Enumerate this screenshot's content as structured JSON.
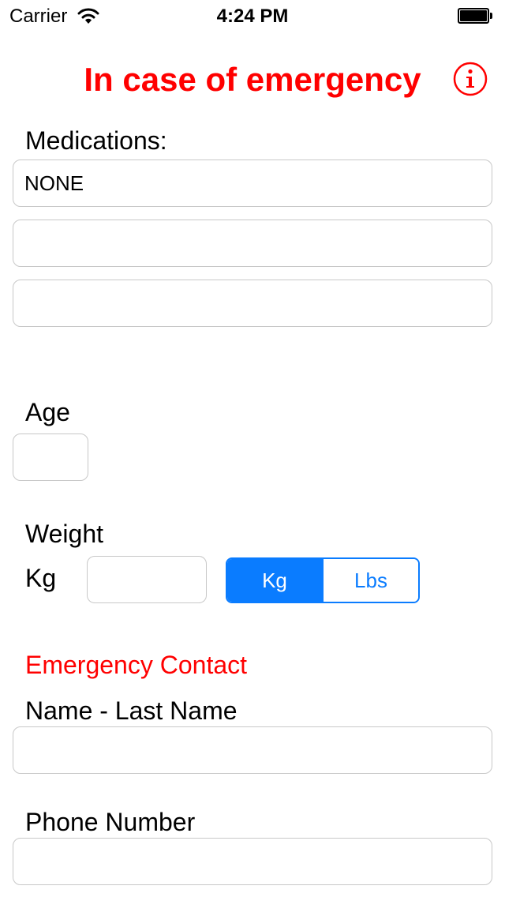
{
  "status_bar": {
    "carrier": "Carrier",
    "time": "4:24 PM",
    "icons": [
      "wifi-icon",
      "battery-icon"
    ]
  },
  "header": {
    "title": "In case of emergency",
    "info_icon": "info-icon",
    "accent_color": "#ff0000"
  },
  "medications": {
    "label": "Medications:",
    "fields": [
      {
        "value": "NONE",
        "placeholder": ""
      },
      {
        "value": "",
        "placeholder": ""
      },
      {
        "value": "",
        "placeholder": ""
      }
    ]
  },
  "age": {
    "label": "Age",
    "value": ""
  },
  "weight": {
    "label": "Weight",
    "unit_label": "Kg",
    "value": "",
    "segments": [
      {
        "label": "Kg",
        "selected": true
      },
      {
        "label": "Lbs",
        "selected": false
      }
    ],
    "tint_color": "#0a7cff"
  },
  "emergency_contact": {
    "section_title": "Emergency Contact",
    "name_label": "Name - Last Name",
    "name_value": "",
    "phone_label": "Phone Number",
    "phone_value": ""
  }
}
